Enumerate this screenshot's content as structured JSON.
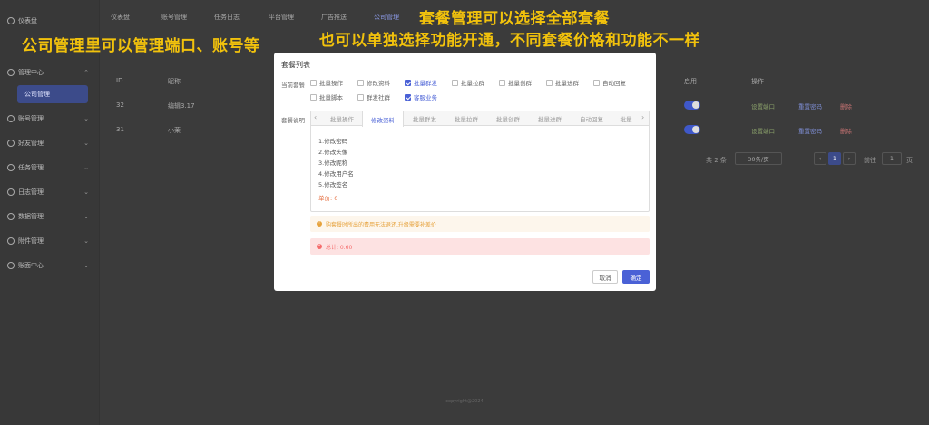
{
  "sidebar": {
    "items": [
      {
        "label": "仪表盘"
      },
      {
        "label": "管理中心"
      },
      {
        "label": "公司管理"
      },
      {
        "label": "账号管理"
      },
      {
        "label": "好友管理"
      },
      {
        "label": "任务管理"
      },
      {
        "label": "日志管理"
      },
      {
        "label": "数据管理"
      },
      {
        "label": "附件管理"
      },
      {
        "label": "账面中心"
      }
    ]
  },
  "tabs": [
    "仪表盘",
    "账号管理",
    "任务日志",
    "平台管理",
    "广告推送",
    "公司管理"
  ],
  "annotations": {
    "left": "公司管理里可以管理端口、账号等",
    "top1": "套餐管理可以选择全部套餐",
    "top2": "也可以单独选择功能开通，不同套餐价格和功能不一样"
  },
  "table": {
    "headers": {
      "id": "ID",
      "name": "昵称",
      "toggle": "启用",
      "ops": "操作"
    },
    "rows": [
      {
        "id": "32",
        "name": "编辑3.17"
      },
      {
        "id": "31",
        "name": "小茉"
      }
    ],
    "actions": {
      "a": "设置端口",
      "b": "重置密码",
      "c": "删除"
    }
  },
  "pagination": {
    "total": "共 2 条",
    "per_page": "30条/页",
    "page": "1",
    "goto": "前往",
    "goto_page": "1",
    "suffix": "页"
  },
  "footer": "copyright@2024",
  "modal": {
    "title": "套餐列表",
    "current_label": "当前套餐",
    "desc_label": "套餐说明",
    "options": [
      {
        "label": "批量操作",
        "checked": false
      },
      {
        "label": "修改资料",
        "checked": false
      },
      {
        "label": "批量群发",
        "checked": true
      },
      {
        "label": "批量拉群",
        "checked": false
      },
      {
        "label": "批量创群",
        "checked": false
      },
      {
        "label": "批量进群",
        "checked": false
      },
      {
        "label": "自动回复",
        "checked": false
      },
      {
        "label": "批量脚本",
        "checked": false
      },
      {
        "label": "群发社群",
        "checked": false
      },
      {
        "label": "客服业务",
        "checked": true
      }
    ],
    "panel_tabs": [
      "批量操作",
      "修改资料",
      "批量群发",
      "批量拉群",
      "批量创群",
      "批量进群",
      "自动回复",
      "批量"
    ],
    "active_tab": 1,
    "lines": [
      "1.修改密码",
      "2.修改头像",
      "3.修改昵称",
      "4.修改用户名",
      "5.修改签名"
    ],
    "price": "单价: 0",
    "warning": "购套餐时所出的费用无法退还,升级需要补差价",
    "total": "总计: 0.60",
    "cancel": "取消",
    "confirm": "确定"
  }
}
